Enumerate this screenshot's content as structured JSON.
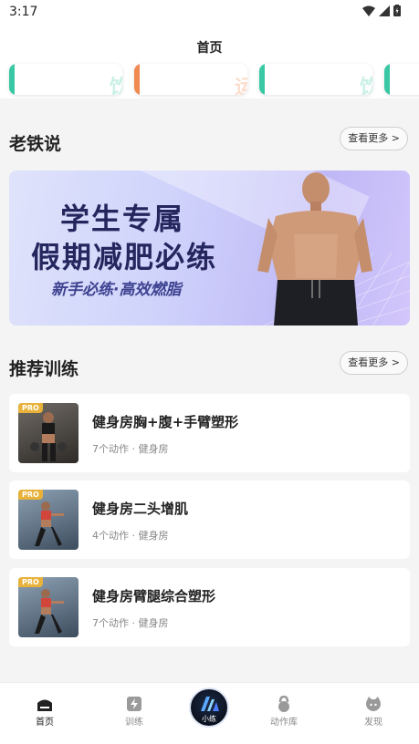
{
  "status": {
    "time": "3:17"
  },
  "header": {
    "title": "首页"
  },
  "strip": {
    "cards": [
      {
        "char": "饮",
        "color": "#39c8a4"
      },
      {
        "char": "运",
        "color": "#f08a50"
      },
      {
        "char": "饮",
        "color": "#39c8a4"
      }
    ]
  },
  "sections": {
    "lao": {
      "title": "老铁说",
      "more_label": "查看更多 >"
    },
    "rec": {
      "title": "推荐训练",
      "more_label": "查看更多 >"
    }
  },
  "banner": {
    "line1": "学生专属",
    "line2": "假期减肥必练",
    "line3": "新手必练·高效燃脂"
  },
  "workouts": [
    {
      "badge": "PRO",
      "title": "健身房胸+腹+手臂塑形",
      "meta": "7个动作 · 健身房"
    },
    {
      "badge": "PRO",
      "title": "健身房二头增肌",
      "meta": "4个动作 · 健身房"
    },
    {
      "badge": "PRO",
      "title": "健身房臂腿综合塑形",
      "meta": "7个动作 · 健身房"
    }
  ],
  "tabbar": {
    "home": "首页",
    "train": "训练",
    "center": "小练",
    "library": "动作库",
    "discover": "发现"
  },
  "colors": {
    "accent_teal": "#39c8a4",
    "accent_orange": "#f08a50",
    "badge": "#e8b13a"
  }
}
